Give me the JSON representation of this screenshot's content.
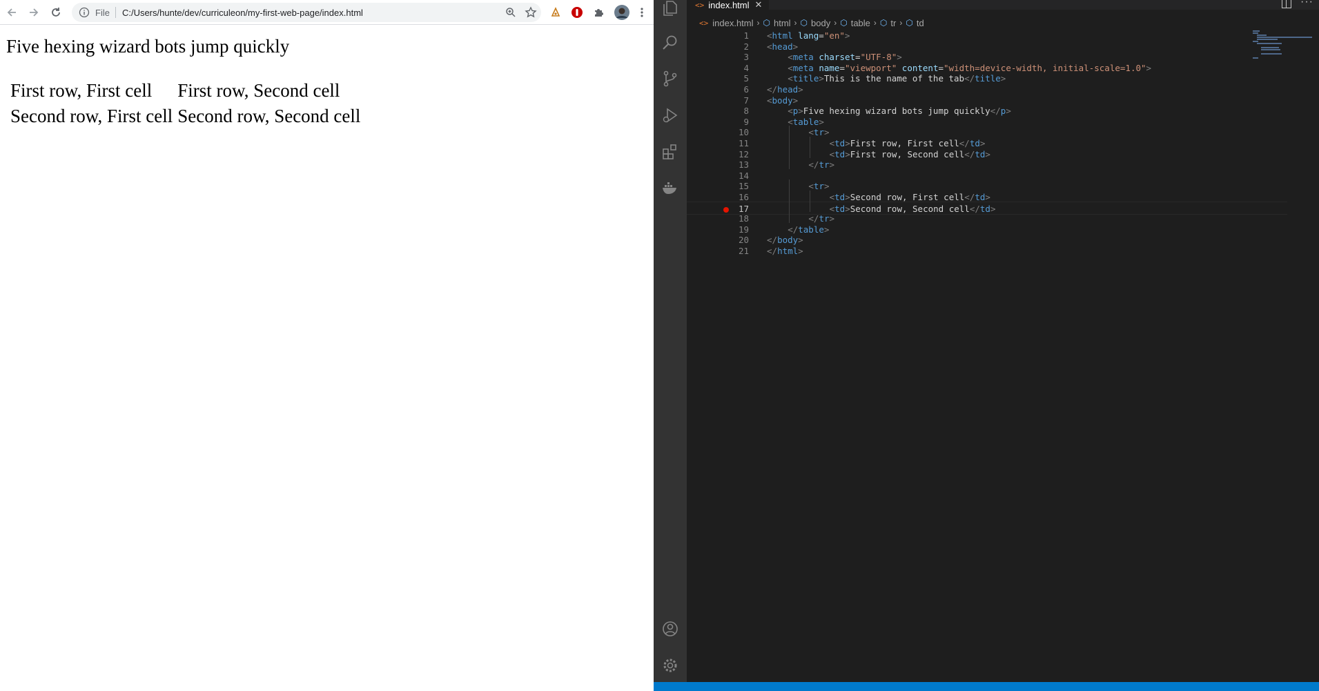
{
  "browser": {
    "scheme": "File",
    "url": "C:/Users/hunte/dev/curriculeon/my-first-web-page/index.html",
    "page": {
      "paragraph": "Five hexing wizard bots jump quickly",
      "table": [
        [
          "First row, First cell",
          "First row, Second cell"
        ],
        [
          "Second row, First cell",
          "Second row, Second cell"
        ]
      ]
    }
  },
  "editor": {
    "tab_title": "index.html",
    "tab_close": "✕",
    "file_glyph": "<>",
    "breadcrumb": [
      "index.html",
      "html",
      "body",
      "table",
      "tr",
      "td"
    ],
    "lines": [
      {
        "n": "1",
        "indent": 0,
        "tokens": [
          [
            "b",
            "<"
          ],
          [
            "t",
            "html"
          ],
          [
            "x",
            " "
          ],
          [
            "a",
            "lang"
          ],
          [
            "x",
            "="
          ],
          [
            "s",
            "\"en\""
          ],
          [
            "b",
            ">"
          ]
        ]
      },
      {
        "n": "2",
        "indent": 0,
        "tokens": [
          [
            "b",
            "<"
          ],
          [
            "t",
            "head"
          ],
          [
            "b",
            ">"
          ]
        ]
      },
      {
        "n": "3",
        "indent": 1,
        "tokens": [
          [
            "b",
            "<"
          ],
          [
            "t",
            "meta"
          ],
          [
            "x",
            " "
          ],
          [
            "a",
            "charset"
          ],
          [
            "x",
            "="
          ],
          [
            "s",
            "\"UTF-8\""
          ],
          [
            "b",
            ">"
          ]
        ]
      },
      {
        "n": "4",
        "indent": 1,
        "tokens": [
          [
            "b",
            "<"
          ],
          [
            "t",
            "meta"
          ],
          [
            "x",
            " "
          ],
          [
            "a",
            "name"
          ],
          [
            "x",
            "="
          ],
          [
            "s",
            "\"viewport\""
          ],
          [
            "x",
            " "
          ],
          [
            "a",
            "content"
          ],
          [
            "x",
            "="
          ],
          [
            "s",
            "\"width=device-width, initial-scale=1.0\""
          ],
          [
            "b",
            ">"
          ]
        ]
      },
      {
        "n": "5",
        "indent": 1,
        "tokens": [
          [
            "b",
            "<"
          ],
          [
            "t",
            "title"
          ],
          [
            "b",
            ">"
          ],
          [
            "x",
            "This is the name of the tab"
          ],
          [
            "b",
            "</"
          ],
          [
            "t",
            "title"
          ],
          [
            "b",
            ">"
          ]
        ]
      },
      {
        "n": "6",
        "indent": 0,
        "tokens": [
          [
            "b",
            "</"
          ],
          [
            "t",
            "head"
          ],
          [
            "b",
            ">"
          ]
        ]
      },
      {
        "n": "7",
        "indent": 0,
        "tokens": [
          [
            "b",
            "<"
          ],
          [
            "t",
            "body"
          ],
          [
            "b",
            ">"
          ]
        ]
      },
      {
        "n": "8",
        "indent": 1,
        "tokens": [
          [
            "b",
            "<"
          ],
          [
            "t",
            "p"
          ],
          [
            "b",
            ">"
          ],
          [
            "x",
            "Five hexing wizard bots jump quickly"
          ],
          [
            "b",
            "</"
          ],
          [
            "t",
            "p"
          ],
          [
            "b",
            ">"
          ]
        ]
      },
      {
        "n": "9",
        "indent": 1,
        "tokens": [
          [
            "b",
            "<"
          ],
          [
            "t",
            "table"
          ],
          [
            "b",
            ">"
          ]
        ]
      },
      {
        "n": "10",
        "indent": 2,
        "tokens": [
          [
            "b",
            "<"
          ],
          [
            "t",
            "tr"
          ],
          [
            "b",
            ">"
          ]
        ]
      },
      {
        "n": "11",
        "indent": 3,
        "tokens": [
          [
            "b",
            "<"
          ],
          [
            "t",
            "td"
          ],
          [
            "b",
            ">"
          ],
          [
            "x",
            "First row, First cell"
          ],
          [
            "b",
            "</"
          ],
          [
            "t",
            "td"
          ],
          [
            "b",
            ">"
          ]
        ]
      },
      {
        "n": "12",
        "indent": 3,
        "tokens": [
          [
            "b",
            "<"
          ],
          [
            "t",
            "td"
          ],
          [
            "b",
            ">"
          ],
          [
            "x",
            "First row, Second cell"
          ],
          [
            "b",
            "</"
          ],
          [
            "t",
            "td"
          ],
          [
            "b",
            ">"
          ]
        ]
      },
      {
        "n": "13",
        "indent": 2,
        "tokens": [
          [
            "b",
            "</"
          ],
          [
            "t",
            "tr"
          ],
          [
            "b",
            ">"
          ]
        ]
      },
      {
        "n": "14",
        "indent": 0,
        "tokens": []
      },
      {
        "n": "15",
        "indent": 2,
        "tokens": [
          [
            "b",
            "<"
          ],
          [
            "t",
            "tr"
          ],
          [
            "b",
            ">"
          ]
        ]
      },
      {
        "n": "16",
        "indent": 3,
        "tokens": [
          [
            "b",
            "<"
          ],
          [
            "t",
            "td"
          ],
          [
            "b",
            ">"
          ],
          [
            "x",
            "Second row, First cell"
          ],
          [
            "b",
            "</"
          ],
          [
            "t",
            "td"
          ],
          [
            "b",
            ">"
          ]
        ]
      },
      {
        "n": "17",
        "indent": 3,
        "tokens": [
          [
            "b",
            "<"
          ],
          [
            "t",
            "td"
          ],
          [
            "b",
            ">"
          ],
          [
            "x",
            "Second row, Second cell"
          ],
          [
            "b",
            "</"
          ],
          [
            "t",
            "td"
          ],
          [
            "b",
            ">"
          ]
        ],
        "current": true,
        "breakpoint": true
      },
      {
        "n": "18",
        "indent": 2,
        "tokens": [
          [
            "b",
            "</"
          ],
          [
            "t",
            "tr"
          ],
          [
            "b",
            ">"
          ]
        ]
      },
      {
        "n": "19",
        "indent": 1,
        "tokens": [
          [
            "b",
            "</"
          ],
          [
            "t",
            "table"
          ],
          [
            "b",
            ">"
          ]
        ]
      },
      {
        "n": "20",
        "indent": 0,
        "tokens": [
          [
            "b",
            "</"
          ],
          [
            "t",
            "body"
          ],
          [
            "b",
            ">"
          ]
        ]
      },
      {
        "n": "21",
        "indent": 0,
        "tokens": [
          [
            "b",
            "</"
          ],
          [
            "t",
            "html"
          ],
          [
            "b",
            ">"
          ]
        ]
      }
    ]
  },
  "colors": {
    "tag": "#569cd6",
    "bracket": "#808080",
    "attribute": "#9cdcfe",
    "string": "#ce9178",
    "text": "#d4d4d4",
    "breakpoint": "#e51400",
    "statusbar": "#007acc"
  },
  "icons": {
    "browser": [
      "back-icon",
      "forward-icon",
      "reload-icon",
      "info-icon",
      "zoom-icon",
      "star-icon",
      "extension-icon",
      "ublock-icon",
      "puzzle-icon",
      "profile-avatar",
      "menu-icon"
    ],
    "activity": [
      "explorer-icon",
      "search-icon",
      "source-control-icon",
      "run-debug-icon",
      "extensions-icon",
      "docker-icon",
      "accounts-icon",
      "settings-gear-icon"
    ]
  }
}
